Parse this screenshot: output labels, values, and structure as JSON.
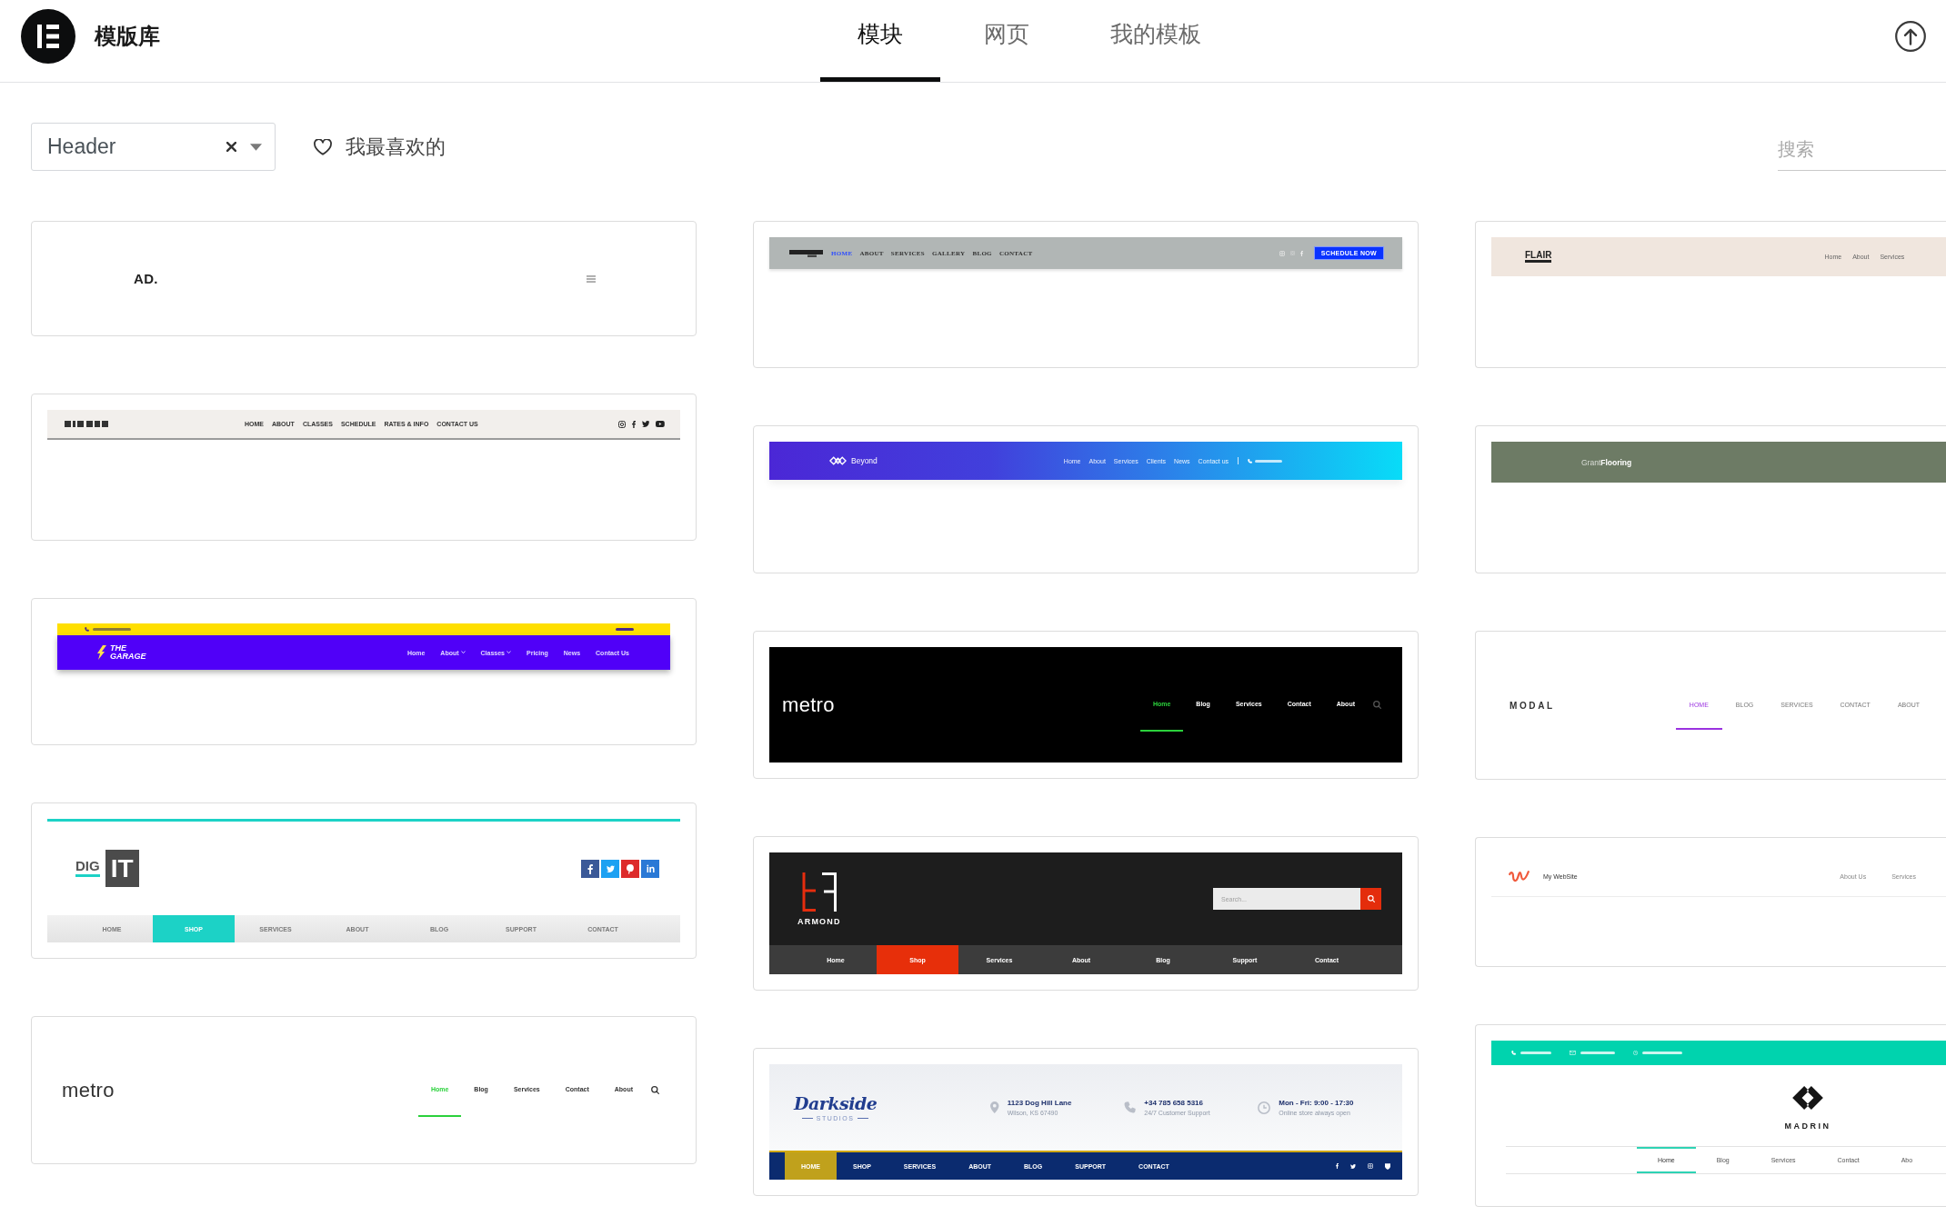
{
  "header": {
    "title": "模版库",
    "tabs": [
      {
        "label": "模块",
        "selected": true
      },
      {
        "label": "网页",
        "selected": false
      },
      {
        "label": "我的模板",
        "selected": false
      }
    ]
  },
  "toolbar": {
    "category": {
      "value": "Header"
    },
    "favorites": {
      "label": "我最喜欢的"
    },
    "search": {
      "placeholder": "搜索"
    }
  },
  "columns": [
    {
      "cards": [
        {
          "kind": "minimal",
          "logo": "AD."
        },
        {
          "kind": "lightbar",
          "nav": [
            {
              "label": "HOME"
            },
            {
              "label": "ABOUT"
            },
            {
              "label": "CLASSES"
            },
            {
              "label": "SCHEDULE"
            },
            {
              "label": "RATES & INFO"
            },
            {
              "label": "CONTACT US"
            }
          ]
        },
        {
          "kind": "garage",
          "logo": "THE GARAGE",
          "nav": [
            {
              "label": "Home",
              "dropdown": false
            },
            {
              "label": "About",
              "dropdown": true
            },
            {
              "label": "Classes",
              "dropdown": true
            },
            {
              "label": "Pricing",
              "dropdown": false
            },
            {
              "label": "News",
              "dropdown": false
            },
            {
              "label": "Contact Us",
              "dropdown": false
            }
          ]
        },
        {
          "kind": "boxed",
          "logo": "DIG",
          "logo_box": "IT",
          "nav": [
            {
              "label": "HOME",
              "selected": false
            },
            {
              "label": "SHOP",
              "selected": true
            },
            {
              "label": "SERVICES",
              "selected": false
            },
            {
              "label": "ABOUT",
              "selected": false
            },
            {
              "label": "BLOG",
              "selected": false
            },
            {
              "label": "SUPPORT",
              "selected": false
            },
            {
              "label": "CONTACT",
              "selected": false
            }
          ]
        },
        {
          "kind": "metro",
          "dark": false,
          "logo": "metro",
          "nav": [
            {
              "label": "Home",
              "selected": true
            },
            {
              "label": "Blog",
              "selected": false
            },
            {
              "label": "Services",
              "selected": false
            },
            {
              "label": "Contact",
              "selected": false
            },
            {
              "label": "About",
              "selected": false
            }
          ]
        }
      ]
    },
    {
      "cards": [
        {
          "kind": "graybar",
          "nav": [
            {
              "label": "HOME",
              "selected": true
            },
            {
              "label": "ABOUT",
              "selected": false
            },
            {
              "label": "SERVICES",
              "selected": false
            },
            {
              "label": "GALLERY",
              "selected": false
            },
            {
              "label": "BLOG",
              "selected": false
            },
            {
              "label": "CONTACT",
              "selected": false
            }
          ],
          "button": "SCHEDULE NOW"
        },
        {
          "kind": "gradient",
          "logo": "Beyond",
          "nav": [
            {
              "label": "Home"
            },
            {
              "label": "About"
            },
            {
              "label": "Services"
            },
            {
              "label": "Clients"
            },
            {
              "label": "News"
            },
            {
              "label": "Contact us"
            }
          ]
        },
        {
          "kind": "metro",
          "dark": true,
          "logo": "metro",
          "nav": [
            {
              "label": "Home",
              "selected": true
            },
            {
              "label": "Blog",
              "selected": false
            },
            {
              "label": "Services",
              "selected": false
            },
            {
              "label": "Contact",
              "selected": false
            },
            {
              "label": "About",
              "selected": false
            }
          ]
        },
        {
          "kind": "searchbar",
          "logo": "ARMOND",
          "search": {
            "placeholder": "Search..."
          },
          "nav": [
            {
              "label": "Home",
              "selected": false
            },
            {
              "label": "Shop",
              "selected": true
            },
            {
              "label": "Services",
              "selected": false
            },
            {
              "label": "About",
              "selected": false
            },
            {
              "label": "Blog",
              "selected": false
            },
            {
              "label": "Support",
              "selected": false
            },
            {
              "label": "Contact",
              "selected": false
            }
          ]
        },
        {
          "kind": "contactbar",
          "logo": "Darkside",
          "tagline": "STUDIOS",
          "info": [
            {
              "title": "1123 Dog Hill Lane",
              "detail": "Wilson, KS 67490"
            },
            {
              "title": "+34 785 658 5316",
              "detail": "24/7 Customer Support"
            },
            {
              "title": "Mon - Fri: 9:00 - 17:30",
              "detail": "Online store always open"
            }
          ],
          "nav": [
            {
              "label": "HOME",
              "selected": true
            },
            {
              "label": "SHOP",
              "selected": false
            },
            {
              "label": "SERVICES",
              "selected": false
            },
            {
              "label": "ABOUT",
              "selected": false
            },
            {
              "label": "BLOG",
              "selected": false
            },
            {
              "label": "SUPPORT",
              "selected": false
            },
            {
              "label": "CONTACT",
              "selected": false
            }
          ]
        }
      ]
    },
    {
      "cards": [
        {
          "kind": "beige",
          "logo": "FLAIR",
          "nav": [
            {
              "label": "Home"
            },
            {
              "label": "About"
            },
            {
              "label": "Services"
            }
          ]
        },
        {
          "kind": "olive",
          "logo": "Grant**Flooring**"
        },
        {
          "kind": "modal",
          "logo": "MODAL",
          "nav": [
            {
              "label": "HOME",
              "selected": true
            },
            {
              "label": "BLOG",
              "selected": false
            },
            {
              "label": "SERVICES",
              "selected": false
            },
            {
              "label": "CONTACT",
              "selected": false
            },
            {
              "label": "ABOUT",
              "selected": false
            }
          ]
        },
        {
          "kind": "divided",
          "logo": "My WebSite",
          "nav": [
            {
              "label": "About Us"
            },
            {
              "label": "Services"
            }
          ]
        },
        {
          "kind": "centered",
          "logo": "MADRIN",
          "nav": [
            {
              "label": "Home",
              "selected": true
            },
            {
              "label": "Blog",
              "selected": false
            },
            {
              "label": "Services",
              "selected": false
            },
            {
              "label": "Contact",
              "selected": false
            },
            {
              "label": "Abo",
              "selected": false
            }
          ]
        }
      ]
    }
  ]
}
